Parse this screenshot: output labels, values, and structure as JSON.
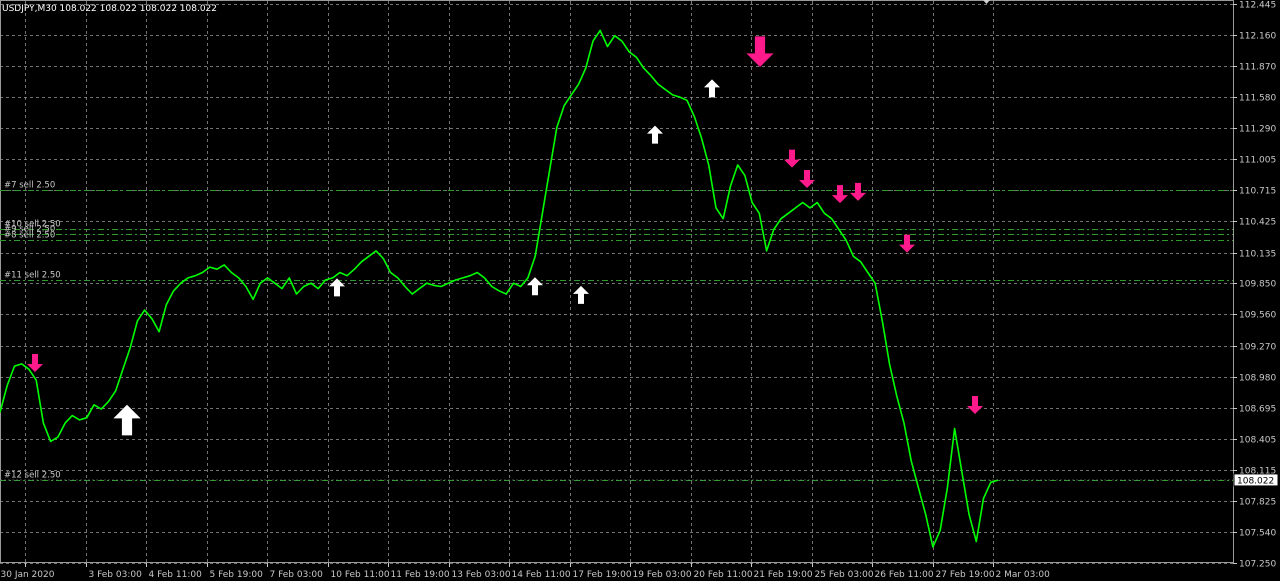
{
  "chart_data": {
    "type": "line",
    "title": "USDJPY,M30  108.022 108.022 108.022 108.022",
    "ylim": [
      107.25,
      112.445
    ],
    "y_ticks": [
      112.445,
      112.16,
      111.87,
      111.58,
      111.29,
      111.005,
      110.715,
      110.425,
      110.135,
      109.85,
      109.56,
      109.27,
      108.98,
      108.695,
      108.405,
      108.115,
      107.825,
      107.54,
      107.25
    ],
    "x_ticks": [
      "30 Jan 2020",
      "3 Feb 03:00",
      "4 Feb 11:00",
      "5 Feb 19:00",
      "7 Feb 03:00",
      "10 Feb 11:00",
      "11 Feb 19:00",
      "13 Feb 03:00",
      "14 Feb 11:00",
      "17 Feb 19:00",
      "19 Feb 03:00",
      "20 Feb 11:00",
      "21 Feb 19:00",
      "25 Feb 03:00",
      "26 Feb 11:00",
      "27 Feb 19:00",
      "2 Mar 03:00"
    ],
    "current_price": "108.022",
    "grid": true,
    "series": [
      {
        "values": [
          108.65,
          108.9,
          109.08,
          109.1,
          109.05,
          108.95,
          108.55,
          108.38,
          108.42,
          108.55,
          108.62,
          108.58,
          108.6,
          108.72,
          108.68,
          108.75,
          108.85,
          109.05,
          109.25,
          109.5,
          109.6,
          109.52,
          109.4,
          109.65,
          109.78,
          109.85,
          109.9,
          109.92,
          109.95,
          110.0,
          109.98,
          110.02,
          109.95,
          109.9,
          109.82,
          109.7,
          109.85,
          109.9,
          109.85,
          109.8,
          109.9,
          109.75,
          109.82,
          109.85,
          109.8,
          109.88,
          109.9,
          109.95,
          109.92,
          109.98,
          110.05,
          110.1,
          110.15,
          110.08,
          109.95,
          109.9,
          109.82,
          109.75,
          109.8,
          109.85,
          109.83,
          109.82,
          109.85,
          109.88,
          109.9,
          109.92,
          109.95,
          109.9,
          109.82,
          109.78,
          109.75,
          109.85,
          109.82,
          109.9,
          110.1,
          110.5,
          110.9,
          111.3,
          111.5,
          111.6,
          111.7,
          111.85,
          112.1,
          112.2,
          112.05,
          112.15,
          112.1,
          112.0,
          111.95,
          111.85,
          111.78,
          111.7,
          111.65,
          111.6,
          111.58,
          111.55,
          111.4,
          111.2,
          110.95,
          110.55,
          110.45,
          110.75,
          110.95,
          110.85,
          110.6,
          110.5,
          110.15,
          110.35,
          110.45,
          110.5,
          110.55,
          110.6,
          110.55,
          110.6,
          110.5,
          110.45,
          110.35,
          110.25,
          110.1,
          110.05,
          109.95,
          109.85,
          109.5,
          109.1,
          108.8,
          108.55,
          108.2,
          107.95,
          107.7,
          107.4,
          107.55,
          107.95,
          108.5,
          108.1,
          107.7,
          107.45,
          107.85,
          108.0,
          108.02
        ],
        "color": "#00ff00"
      }
    ],
    "horizontal_lines": [
      {
        "label": "#7 sell 2.50",
        "price": 110.715
      },
      {
        "label": "#10 sell 2.50",
        "price": 110.355
      },
      {
        "label": "#9 sell 2.50",
        "price": 110.305
      },
      {
        "label": "#8 sell 2.50",
        "price": 110.255
      },
      {
        "label": "#11 sell 2.50",
        "price": 109.88
      },
      {
        "label": "#12 sell 2.50",
        "price": 108.022
      }
    ],
    "arrows": [
      {
        "dir": "up",
        "x": "4 Feb 11:00",
        "price": 108.61,
        "size": "large"
      },
      {
        "dir": "up",
        "x": "10 Feb 11:00",
        "price": 109.83,
        "size": "small"
      },
      {
        "dir": "up",
        "x": "14 Feb 11:00",
        "price": 109.84,
        "size": "small"
      },
      {
        "dir": "up",
        "x": "17 Feb 19:00",
        "price": 109.76,
        "size": "small"
      },
      {
        "dir": "up",
        "x": "19 Feb 03:00",
        "price": 111.25,
        "size": "small"
      },
      {
        "dir": "up",
        "x": "20 Feb 11:00",
        "price": 111.68,
        "size": "small"
      },
      {
        "dir": "down",
        "x": "30 Jan 2020",
        "price": 109.09,
        "size": "small"
      },
      {
        "dir": "down",
        "x": "21 Feb 19:00",
        "price": 111.97,
        "size": "large"
      },
      {
        "dir": "down",
        "x": "25 Feb 03:00",
        "price": 110.99,
        "size": "small"
      },
      {
        "dir": "down",
        "x": "25 Feb 03:00",
        "price": 110.8,
        "size": "small"
      },
      {
        "dir": "down",
        "x": "26 Feb 11:00",
        "price": 110.66,
        "size": "small"
      },
      {
        "dir": "down",
        "x": "26 Feb 11:00",
        "price": 110.68,
        "size": "small"
      },
      {
        "dir": "down",
        "x": "27 Feb 19:00",
        "price": 110.2,
        "size": "small"
      },
      {
        "dir": "down",
        "x": "2 Mar 03:00",
        "price": 108.7,
        "size": "small"
      }
    ],
    "colors": {
      "background": "#000000",
      "grid": "#9a9a9a",
      "price_line": "#00ff00",
      "sell_line": "#2e9a2e",
      "arrow_up": "#ffffff",
      "arrow_down": "#ff1a8c",
      "axis": "#c8c8c8"
    }
  }
}
